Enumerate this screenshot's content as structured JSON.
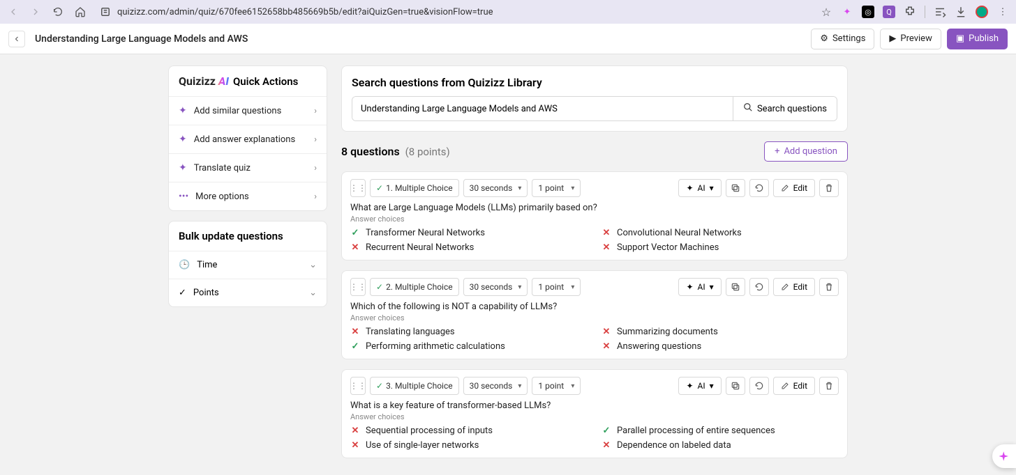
{
  "browser": {
    "url": "quizizz.com/admin/quiz/670fee6152658bb485669b5b/edit?aiQuizGen=true&visionFlow=true"
  },
  "header": {
    "title": "Understanding Large Language Models and AWS",
    "settings": "Settings",
    "preview": "Preview",
    "publish": "Publish"
  },
  "quickActions": {
    "title": "Quick Actions",
    "items": [
      "Add similar questions",
      "Add answer explanations",
      "Translate quiz",
      "More options"
    ]
  },
  "bulk": {
    "title": "Bulk update questions",
    "items": [
      "Time",
      "Points"
    ]
  },
  "search": {
    "title": "Search questions from Quizizz Library",
    "value": "Understanding Large Language Models and AWS",
    "button": "Search questions"
  },
  "questionsHeader": {
    "count": "8 questions",
    "points": "(8 points)",
    "add": "Add question"
  },
  "toolbar": {
    "ai": "AI",
    "edit": "Edit"
  },
  "questions": [
    {
      "type": "1. Multiple Choice",
      "time": "30 seconds",
      "points": "1 point",
      "text": "What are Large Language Models (LLMs) primarily based on?",
      "choicesLabel": "Answer choices",
      "answers": [
        {
          "t": "Transformer Neural Networks",
          "ok": true
        },
        {
          "t": "Convolutional Neural Networks",
          "ok": false
        },
        {
          "t": "Recurrent Neural Networks",
          "ok": false
        },
        {
          "t": "Support Vector Machines",
          "ok": false
        }
      ]
    },
    {
      "type": "2. Multiple Choice",
      "time": "30 seconds",
      "points": "1 point",
      "text": "Which of the following is NOT a capability of LLMs?",
      "choicesLabel": "Answer choices",
      "answers": [
        {
          "t": "Translating languages",
          "ok": false
        },
        {
          "t": "Summarizing documents",
          "ok": false
        },
        {
          "t": "Performing arithmetic calculations",
          "ok": true
        },
        {
          "t": "Answering questions",
          "ok": false
        }
      ]
    },
    {
      "type": "3. Multiple Choice",
      "time": "30 seconds",
      "points": "1 point",
      "text": "What is a key feature of transformer-based LLMs?",
      "choicesLabel": "Answer choices",
      "answers": [
        {
          "t": "Sequential processing of inputs",
          "ok": false
        },
        {
          "t": "Parallel processing of entire sequences",
          "ok": true
        },
        {
          "t": "Use of single-layer networks",
          "ok": false
        },
        {
          "t": "Dependence on labeled data",
          "ok": false
        }
      ]
    }
  ]
}
